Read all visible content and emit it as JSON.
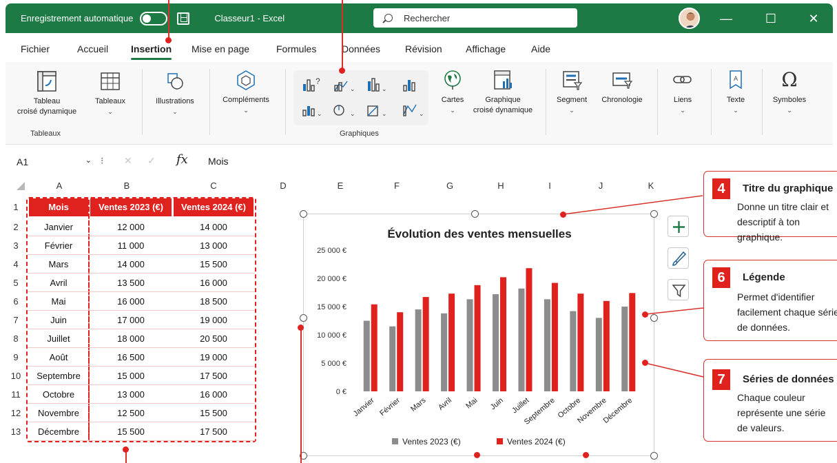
{
  "titlebar": {
    "autosave_label": "Enregistrement automatique",
    "doc_title": "Classeur1  -  Excel",
    "search_placeholder": "Rechercher",
    "minimize": "—",
    "maximize": "☐",
    "close": "✕"
  },
  "tabs": [
    "Fichier",
    "Accueil",
    "Insertion",
    "Mise en page",
    "Formules",
    "Données",
    "Révision",
    "Affichage",
    "Aide"
  ],
  "active_tab": "Insertion",
  "ribbon": {
    "pivot_table": [
      "Tableau",
      "croisé dynamique"
    ],
    "tables": "Tableaux",
    "tables_group": "Tableaux",
    "illustrations": "Illustrations",
    "addins": "Compléments",
    "maps": "Cartes",
    "pivot_chart": [
      "Graphique",
      "croisé dynamique"
    ],
    "charts_group": "Graphiques",
    "slicer": "Segment",
    "timeline": "Chronologie",
    "links": "Liens",
    "text": "Texte",
    "symbols": "Symboles"
  },
  "formula_bar": {
    "name_box": "A1",
    "fx": "fx",
    "content": "Mois"
  },
  "sheet": {
    "columns": [
      "A",
      "B",
      "C",
      "D",
      "E",
      "F",
      "G",
      "H",
      "I",
      "J",
      "K"
    ],
    "rows": [
      "1",
      "2",
      "3",
      "4",
      "5",
      "6",
      "7",
      "8",
      "9",
      "10",
      "11",
      "12",
      "13"
    ],
    "headers": [
      "Mois",
      "Ventes 2023 (€)",
      "Ventes 2024 (€)"
    ],
    "data": [
      [
        "Janvier",
        "12 000",
        "14 000"
      ],
      [
        "Février",
        "11 000",
        "13 000"
      ],
      [
        "Mars",
        "14 000",
        "15 500"
      ],
      [
        "Avril",
        "13 500",
        "16 000"
      ],
      [
        "Mai",
        "16 000",
        "18 500"
      ],
      [
        "Juin",
        "17 000",
        "19 000"
      ],
      [
        "Juillet",
        "18 000",
        "20 500"
      ],
      [
        "Août",
        "16 500",
        "19 000"
      ],
      [
        "Septembre",
        "15 000",
        "17 500"
      ],
      [
        "Octobre",
        "13 000",
        "16 000"
      ],
      [
        "Novembre",
        "12 500",
        "15 500"
      ],
      [
        "Décembre",
        "15 500",
        "17 500"
      ]
    ]
  },
  "chart_data": {
    "type": "bar",
    "title": "Évolution des ventes mensuelles",
    "categories": [
      "Janvier",
      "Février",
      "Mars",
      "Avril",
      "Mai",
      "Juin",
      "Juillet",
      "Septembre",
      "Octobre",
      "Novembre",
      "Décembre"
    ],
    "series": [
      {
        "name": "Ventes 2023 (€)",
        "color": "#8c8c8c",
        "values": [
          12500,
          11500,
          14500,
          13800,
          16300,
          17200,
          18200,
          16300,
          14200,
          13000,
          15000
        ]
      },
      {
        "name": "Ventes 2024 (€)",
        "color": "#e0221f",
        "values": [
          15400,
          14000,
          16700,
          17300,
          18800,
          20200,
          21800,
          19200,
          17300,
          16000,
          17400
        ]
      }
    ],
    "y_ticks": [
      "0 €",
      "5 000 €",
      "10 000 €",
      "15 000 €",
      "20 000 €",
      "25 000 €"
    ],
    "ylim": [
      0,
      25000
    ],
    "legend_position": "bottom",
    "grid": false
  },
  "callouts": [
    {
      "num": "4",
      "title": "Titre du graphique",
      "desc": [
        "Donne un titre clair et",
        "descriptif à ton graphique."
      ]
    },
    {
      "num": "6",
      "title": "Légende",
      "desc": [
        "Permet d'identifier",
        "facilement chaque série",
        "de données."
      ]
    },
    {
      "num": "7",
      "title": "Séries de données",
      "desc": [
        "Chaque couleur",
        "représente une série",
        "de valeurs."
      ]
    }
  ]
}
